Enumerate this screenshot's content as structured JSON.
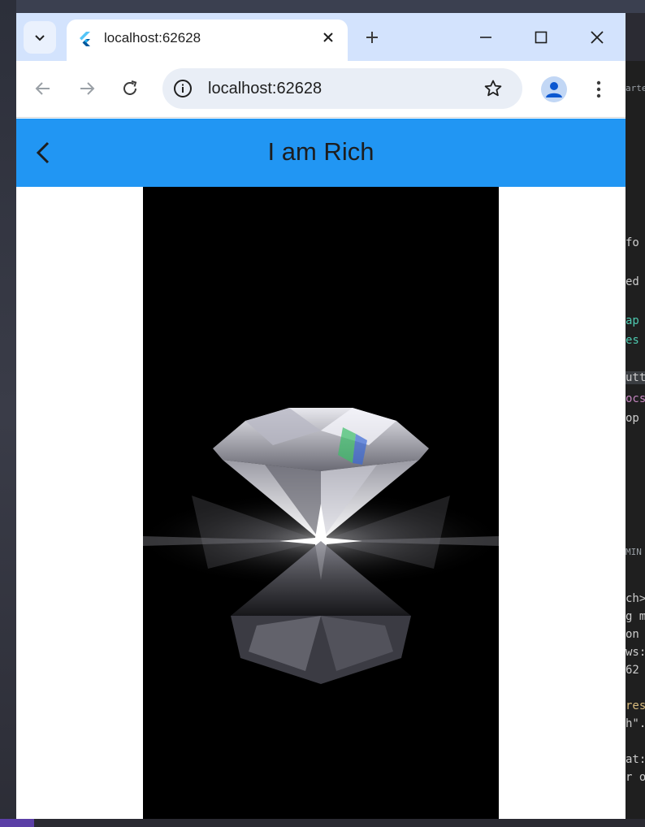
{
  "browser": {
    "tab_title": "localhost:62628",
    "address": "localhost:62628",
    "tab_search_icon": "chevron-down-icon",
    "favicon": "flutter-logo-icon"
  },
  "app": {
    "title": "I am Rich",
    "appbar_color": "#2196f3",
    "image_description_icon": "diamond-icon"
  },
  "background_editor": {
    "lines": [
      "arte",
      "fo",
      "ed",
      "ap",
      "es",
      "utt",
      "ocs",
      "op",
      "MIN",
      "ch>",
      "g m",
      "on",
      "ws:",
      "62",
      "res",
      "h\".",
      "at:",
      "r o"
    ]
  }
}
